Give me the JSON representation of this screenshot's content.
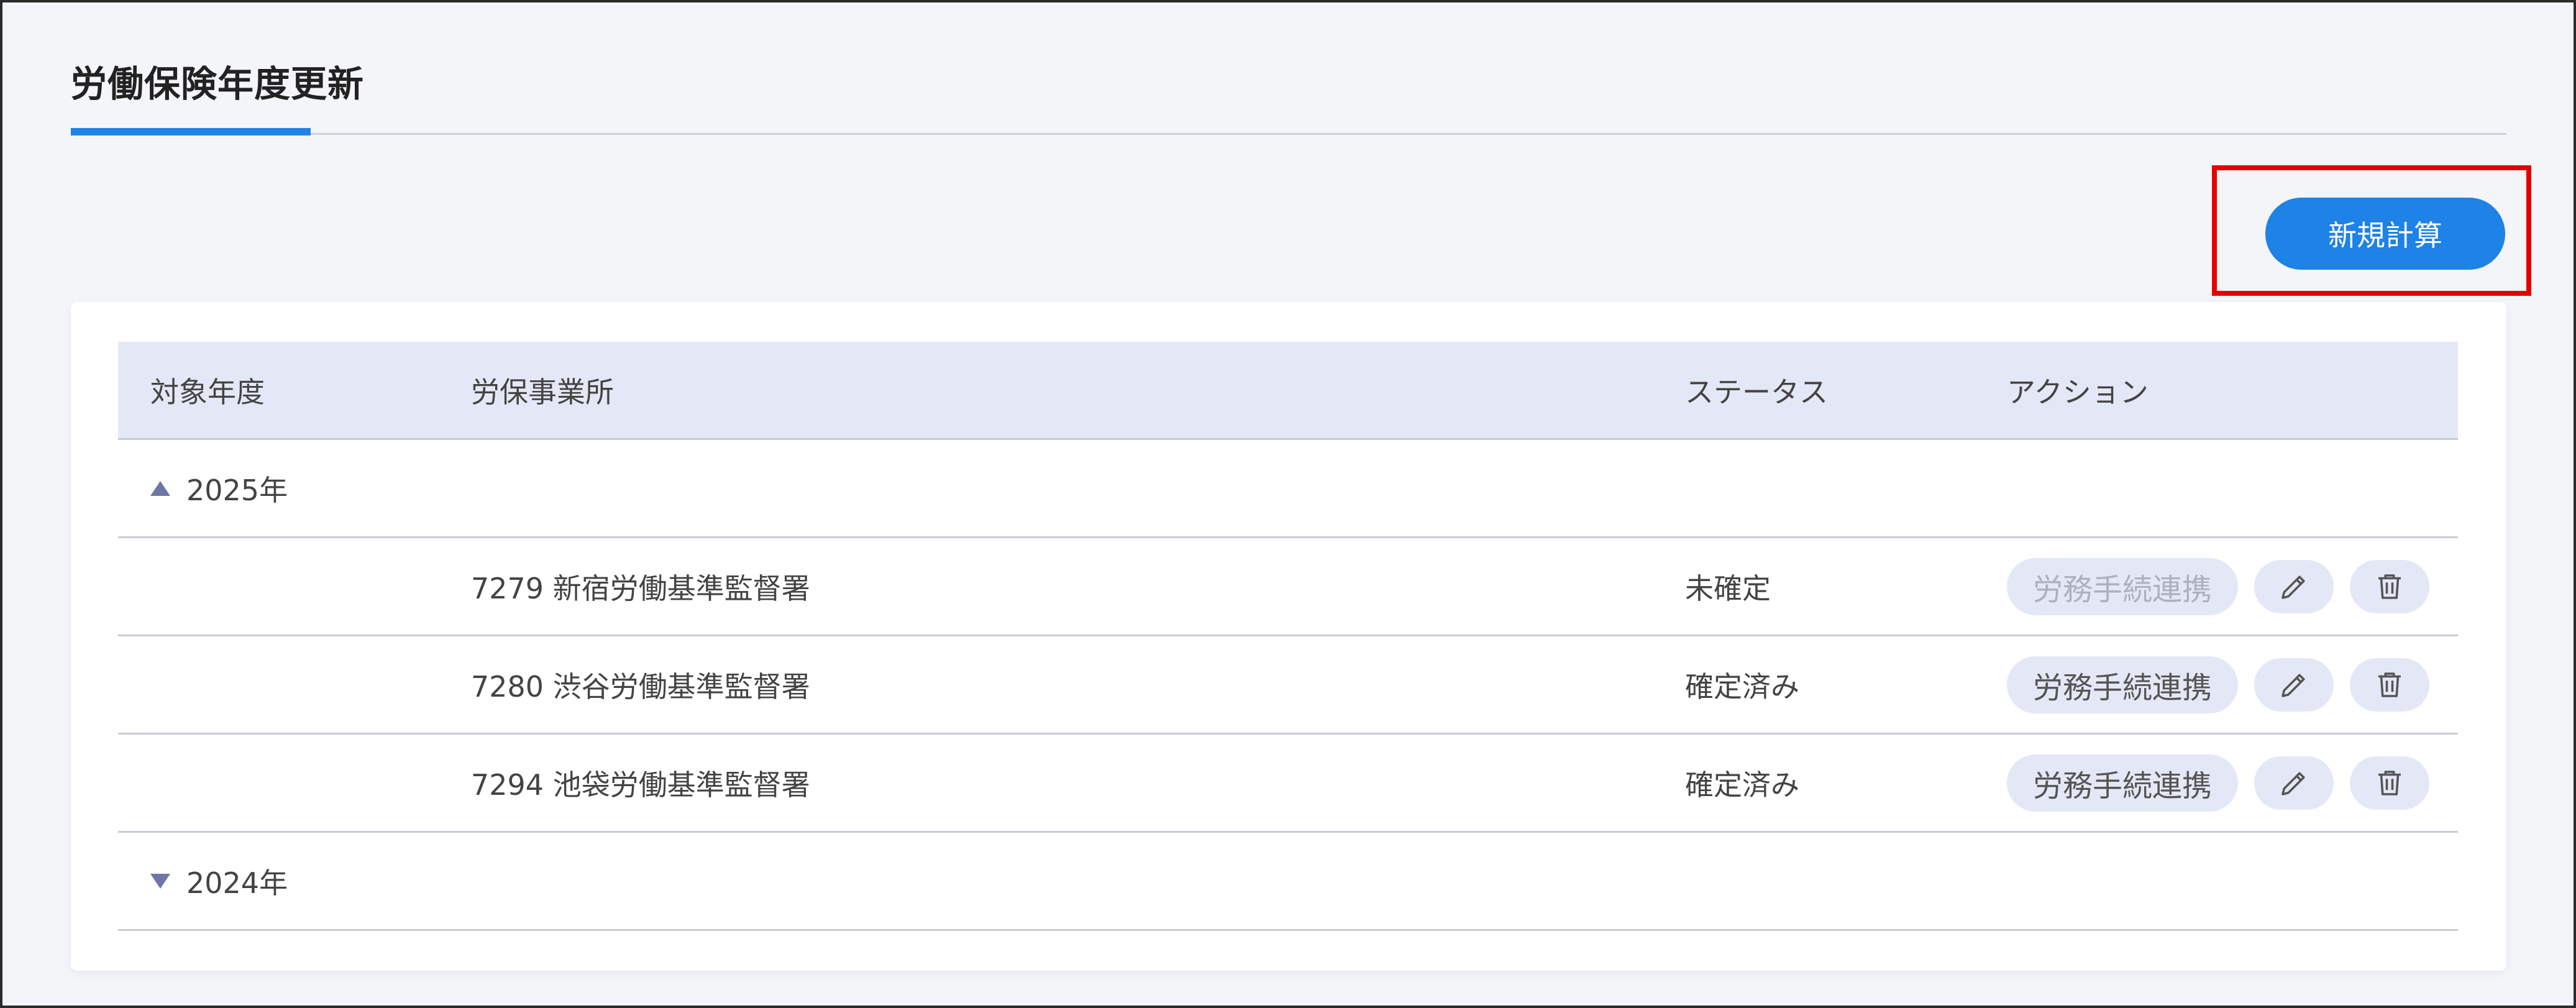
{
  "page": {
    "title": "労働保険年度更新"
  },
  "toolbar": {
    "new_label": "新規計算"
  },
  "table": {
    "headers": {
      "year": "対象年度",
      "office": "労保事業所",
      "status": "ステータス",
      "action": "アクション"
    },
    "groups": [
      {
        "label": "2025年",
        "expanded": true,
        "rows": [
          {
            "office": "7279 新宿労働基準監督署",
            "status": "未確定",
            "link_label": "労務手続連携",
            "link_enabled": false
          },
          {
            "office": "7280 渋谷労働基準監督署",
            "status": "確定済み",
            "link_label": "労務手続連携",
            "link_enabled": true
          },
          {
            "office": "7294 池袋労働基準監督署",
            "status": "確定済み",
            "link_label": "労務手続連携",
            "link_enabled": true
          }
        ]
      },
      {
        "label": "2024年",
        "expanded": false,
        "rows": []
      }
    ]
  },
  "icons": {
    "expand": "triangle-up-icon",
    "collapse": "triangle-down-icon",
    "edit": "pencil-icon",
    "delete": "trash-icon"
  },
  "colors": {
    "accent": "#1e82e6",
    "highlight": "#e30000",
    "header_bg": "#e4e8f6",
    "page_bg": "#f4f5f9"
  }
}
